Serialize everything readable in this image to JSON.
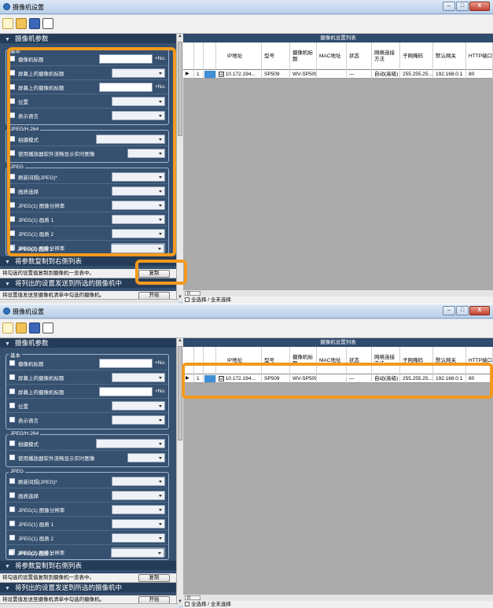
{
  "window": {
    "title": "摄像机设置",
    "min": "–",
    "max": "□",
    "close": "X"
  },
  "left": {
    "section1": "摄像机参数",
    "group_basic": "基本",
    "rows_basic": [
      "摄像机标题",
      "屏幕上的摄像机标题",
      "屏幕上的摄像机标题",
      "位置",
      "表示语言"
    ],
    "no_suffix": "+No.",
    "group_jpeg_h264": "JPEG/H.264",
    "rows_jpeg_h264": [
      "拍摄模式",
      "使用播放器软件流畅显示实时图像"
    ],
    "group_jpeg": "JPEG",
    "rows_jpeg": [
      "刷新间隔(JPEG)*",
      "画质选择",
      "JPEG(1) 图像分辨率",
      "JPEG(1) 画质 1",
      "JPEG(1) 画质 2",
      "JPEG(2) 图像分辨率",
      "JPEG(2) 画质 1"
    ],
    "section2": "将参数复制到右侧列表",
    "copy_desc": "将勾选的设置值复制到摄像机一览表中。",
    "copy_button": "复制",
    "section3": "将列出的设置发送到所选的摄像机中",
    "send_desc": "将设置值发送至摄像机清单中勾选的摄像机。",
    "send_button": "开始"
  },
  "right": {
    "table_title": "摄像机设置列表",
    "columns": [
      "",
      "",
      "",
      "IP地址",
      "型号",
      "摄像机标题",
      "MAC地址",
      "状态",
      "网络连接方法",
      "子网掩码",
      "默认网关",
      "HTTP端口"
    ],
    "rows": [
      {
        "arrow": "▶",
        "num": "1",
        "check": "☑",
        "ip": "10.172.194...",
        "model": "SP509",
        "title": "WV-SP509",
        "mac": "",
        "status": "—",
        "method": "自动(高级)",
        "mask": "255.255.25...",
        "gateway": "192.168.0.1",
        "port": "80"
      }
    ],
    "hscroll_label": "|||",
    "select_all": "全选择 / 全未选择"
  },
  "colors": {
    "panel": "#36506f",
    "header": "#253c58",
    "highlight": "#f39a1e",
    "tablebg": "#ababab"
  }
}
